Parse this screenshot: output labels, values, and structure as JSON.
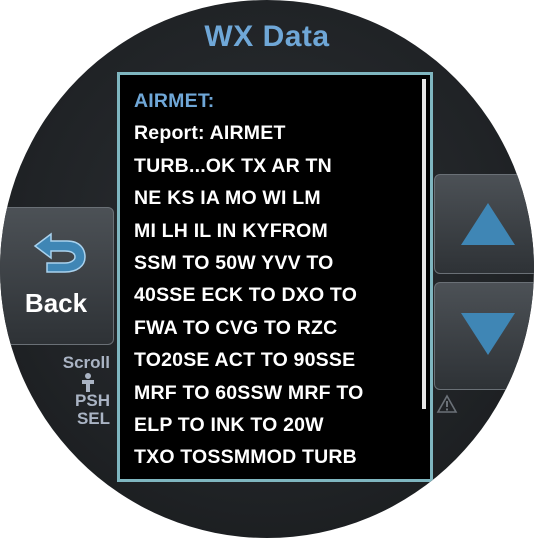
{
  "title": "WX Data",
  "report": {
    "lines": [
      "AIRMET:",
      "Report: AIRMET",
      "TURB...OK TX AR TN",
      "NE KS IA MO WI LM",
      "MI LH IL IN KYFROM",
      "SSM TO 50W YVV TO",
      "40SSE ECK TO DXO TO",
      "FWA TO CVG TO RZC",
      "TO20SE ACT TO 90SSE",
      "MRF TO 60SSW MRF TO",
      "ELP TO INK TO 20W",
      "TXO TOSSMMOD TURB"
    ]
  },
  "buttons": {
    "back_label": "Back",
    "back_icon": "back-arrow-icon",
    "scroll_up_icon": "up-arrow-icon",
    "scroll_down_icon": "down-arrow-icon"
  },
  "knob_hint": {
    "line1": "Scroll",
    "icon": "knob-icon",
    "line2": "PSH",
    "line3": "SEL"
  },
  "colors": {
    "title": "#6fa7d7",
    "panel_border": "#7fb6c0",
    "arrow_fill": "#3f86b5",
    "hint_text": "#aab4c4"
  }
}
